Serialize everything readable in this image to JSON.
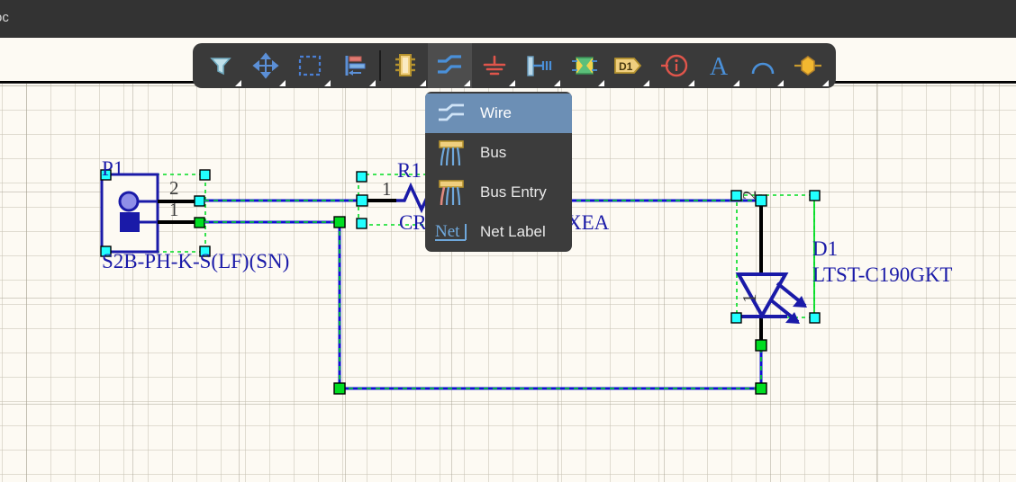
{
  "window": {
    "tab_label_clipped": "oc"
  },
  "toolbar": {
    "buttons": [
      {
        "name": "filter-tool",
        "icon": "funnel-icon",
        "active": false,
        "has_submenu": true
      },
      {
        "name": "move-tool",
        "icon": "move-arrows-icon",
        "active": false,
        "has_submenu": true
      },
      {
        "name": "area-select-tool",
        "icon": "dashed-rect-icon",
        "active": false,
        "has_submenu": true
      },
      {
        "name": "align-tool",
        "icon": "align-left-icon",
        "active": false,
        "has_submenu": true
      },
      {
        "name": "place-component",
        "icon": "ic-chip-icon",
        "active": false,
        "has_submenu": true
      },
      {
        "name": "place-wire",
        "icon": "wire-icon",
        "active": true,
        "has_submenu": true
      },
      {
        "name": "place-ground",
        "icon": "ground-icon",
        "active": false,
        "has_submenu": true
      },
      {
        "name": "place-port",
        "icon": "port-icon",
        "active": false,
        "has_submenu": true
      },
      {
        "name": "place-sheet-symbol",
        "icon": "sheet-symbol-icon",
        "active": false,
        "has_submenu": true
      },
      {
        "name": "place-designator",
        "icon": "designator-icon",
        "active": false,
        "has_submenu": true
      },
      {
        "name": "place-no-erc",
        "icon": "info-circle-icon",
        "active": false,
        "has_submenu": true
      },
      {
        "name": "place-text",
        "icon": "text-a-icon",
        "active": false,
        "has_submenu": true
      },
      {
        "name": "place-arc",
        "icon": "arc-icon",
        "active": false,
        "has_submenu": true
      },
      {
        "name": "place-polygon",
        "icon": "polygon-icon",
        "active": false,
        "has_submenu": true
      }
    ]
  },
  "dropdown": {
    "items": [
      {
        "label": "Wire",
        "icon": "wire-icon",
        "selected": true
      },
      {
        "label": "Bus",
        "icon": "bus-icon",
        "selected": false
      },
      {
        "label": "Bus Entry",
        "icon": "bus-entry-icon",
        "selected": false
      },
      {
        "label": "Net Label",
        "icon": "net-label-icon",
        "selected": false
      }
    ]
  },
  "schematic": {
    "components": [
      {
        "designator": "P1",
        "part_number": "S2B-PH-K-S(LF)(SN)",
        "type": "connector-2pin",
        "pins": [
          "2",
          "1"
        ],
        "selected": true
      },
      {
        "designator": "R1",
        "part_number_visible": "XEA",
        "part_number_clipped_prefix": "CR",
        "type": "resistor",
        "pins": [
          "1"
        ],
        "selected": true
      },
      {
        "designator": "D1",
        "part_number": "LTST-C190GKT",
        "type": "led",
        "pins": [
          "2",
          "1"
        ],
        "selected": true
      }
    ],
    "colors": {
      "symbol_blue": "#1a1aa8",
      "wire_black": "#000000",
      "selection_green": "#00dd22",
      "handle_cyan": "#22ffff",
      "handle_green": "#00dd22",
      "net_blue": "#1010d0",
      "canvas_bg": "#fdfaf3"
    }
  }
}
